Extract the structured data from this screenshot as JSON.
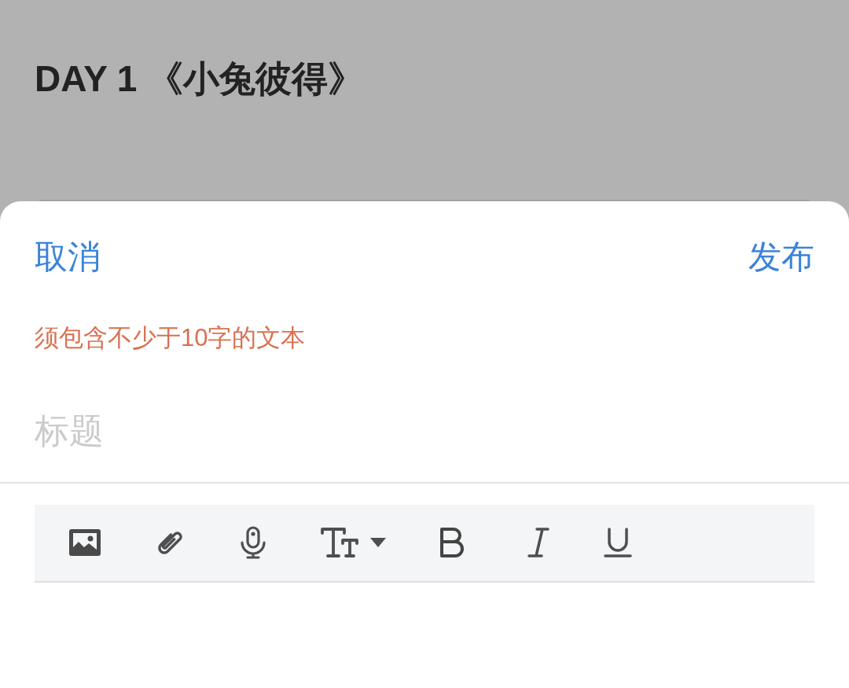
{
  "background_page": {
    "title": "DAY 1 《小兔彼得》"
  },
  "sheet": {
    "cancel_button": "取消",
    "publish_button": "发布",
    "error_message": "须包含不少于10字的文本",
    "title_field": {
      "placeholder": "标题"
    }
  }
}
